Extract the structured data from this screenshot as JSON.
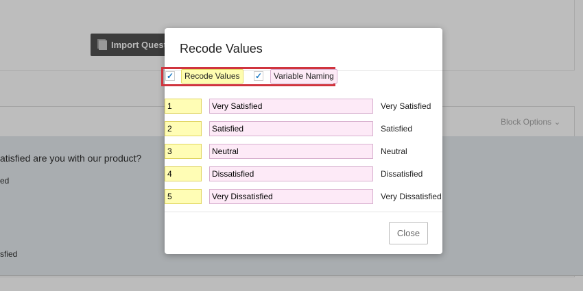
{
  "background": {
    "import_button": "Import Quest",
    "block_options": "Block Options",
    "question_text": "atisfied are you with our product?",
    "option_fragments": [
      "ed",
      "sfied"
    ]
  },
  "modal": {
    "title": "Recode Values",
    "toggles": [
      {
        "label": "Recode Values",
        "checked": true
      },
      {
        "label": "Variable Naming",
        "checked": true
      }
    ],
    "rows": [
      {
        "value": "1",
        "name": "Very Satisfied",
        "label": "Very Satisfied"
      },
      {
        "value": "2",
        "name": "Satisfied",
        "label": "Satisfied"
      },
      {
        "value": "3",
        "name": "Neutral",
        "label": "Neutral"
      },
      {
        "value": "4",
        "name": "Dissatisfied",
        "label": "Dissatisfied"
      },
      {
        "value": "5",
        "name": "Very Dissatisfied",
        "label": "Very Dissatisfied"
      }
    ],
    "close_label": "Close"
  }
}
